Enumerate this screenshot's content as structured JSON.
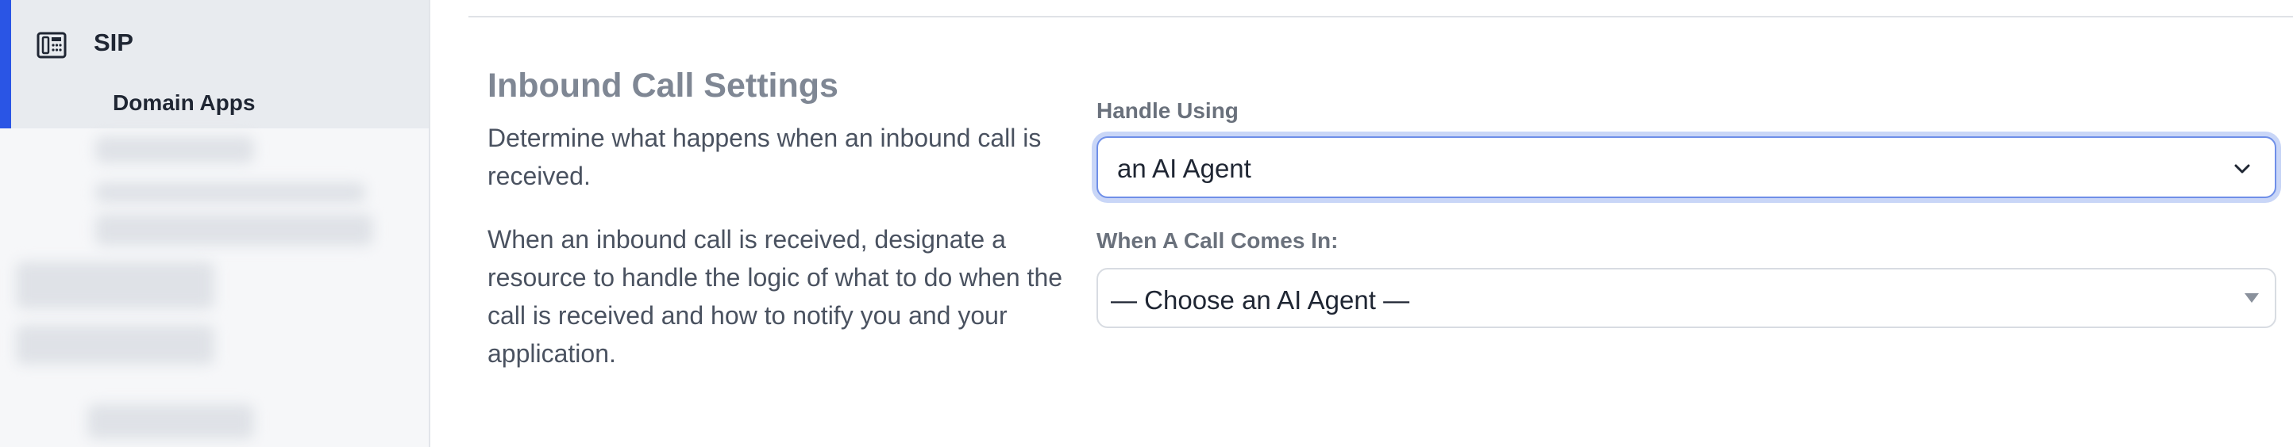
{
  "sidebar": {
    "active_item": {
      "label": "SIP",
      "icon": "sip-phone-icon",
      "subitem_label": "Domain Apps"
    }
  },
  "main": {
    "section_title": "Inbound Call Settings",
    "description_1": "Determine what happens when an inbound call is received.",
    "description_2": "When an inbound call is received, designate a resource to handle the logic of what to do when the call is received and how to notify you and your application.",
    "handle_using": {
      "label": "Handle Using",
      "value": "an AI Agent"
    },
    "when_call_comes_in": {
      "label": "When A Call Comes In:",
      "value": "— Choose an AI Agent —"
    }
  },
  "colors": {
    "accent": "#2a55e5",
    "focus_ring": "#c9d6f7",
    "title_gray": "#7f8794"
  }
}
